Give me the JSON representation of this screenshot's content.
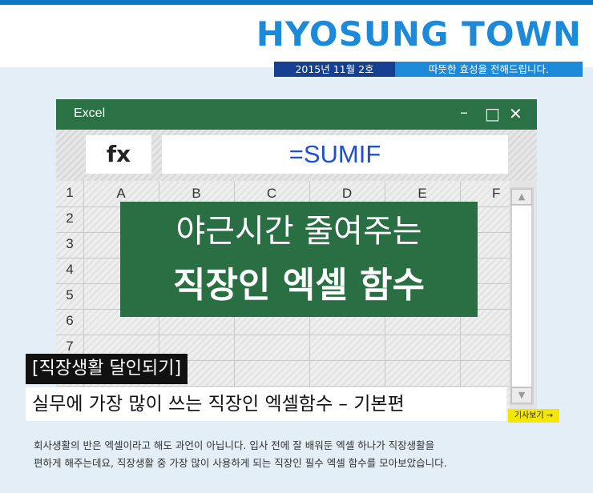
{
  "header": {
    "brand": "HYOSUNG TOWN",
    "issue": "2015년 11월 2호",
    "tagline": "따뜻한 효성을 전해드립니다.",
    "accent_color": "#1c8ad8"
  },
  "excel_window": {
    "title": "Excel",
    "controls": {
      "minimize": "–",
      "maximize": "□",
      "close": "✕"
    },
    "fx_label": "fx",
    "formula": "=SUMIF",
    "columns": [
      "A",
      "B",
      "C",
      "D",
      "E",
      "F"
    ],
    "rows": [
      "1",
      "2",
      "3",
      "4",
      "5",
      "6",
      "7"
    ],
    "scroll_up_icon": "▲",
    "scroll_down_icon": "▼",
    "theme_color": "#2b7146"
  },
  "overlay": {
    "line1": "야근시간 줄여주는",
    "line2": "직장인 엑셀 함수"
  },
  "article": {
    "category": "[직장생활 달인되기]",
    "headline": "실무에 가장 많이 쓰는 직장인 엑셀함수 – 기본편",
    "more_label": "기사보기 →",
    "description_line1": "회사생활의 반은 엑셀이라고 해도 과언이 아닙니다. 입사 전에 잘 배워둔 엑셀 하나가 직장생활을",
    "description_line2": "편하게 해주는데요, 직장생활 중 가장 많이 사용하게 되는 직장인 필수 엑셀 함수를 모아보았습니다."
  }
}
